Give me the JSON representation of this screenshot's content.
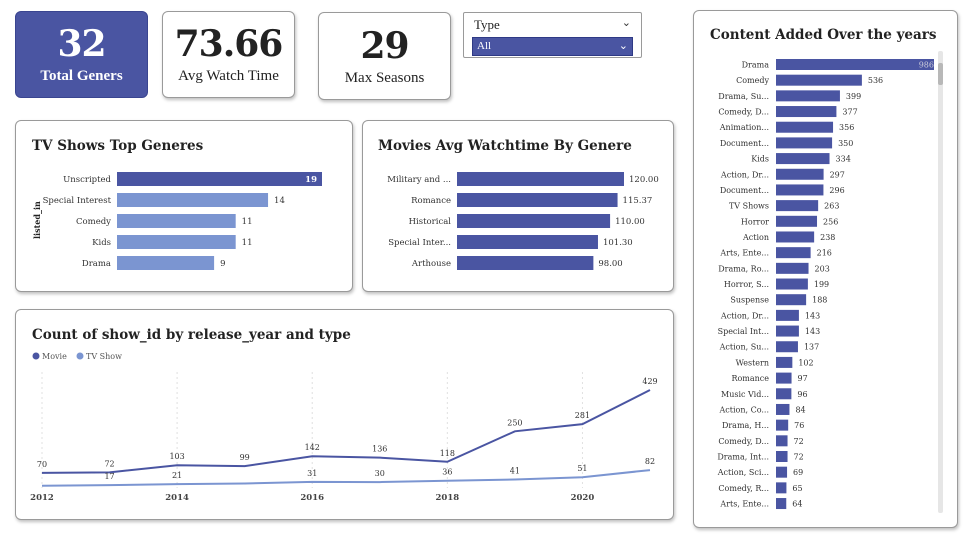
{
  "colors": {
    "primary": "#4a55a2",
    "secondary": "#7b95d1",
    "grid": "#e0e0e0"
  },
  "kpis": [
    {
      "value": "32",
      "label": "Total Geners"
    },
    {
      "value": "73.66",
      "label": "Avg Watch Time"
    },
    {
      "value": "29",
      "label": "Max Seasons"
    }
  ],
  "slicer": {
    "label": "Type",
    "selected": "All",
    "icon": "chevron-down-icon"
  },
  "tv_chart": {
    "title": "TV Shows Top Generes",
    "ylabel": "listed_in",
    "categories": [
      "Unscripted",
      "Special Interest",
      "Comedy",
      "Kids",
      "Drama"
    ],
    "values": [
      19,
      14,
      11,
      11,
      9
    ],
    "labels": [
      "19",
      "14",
      "11",
      "11",
      "9"
    ]
  },
  "movies_chart": {
    "title": "Movies Avg Watchtime By Genere",
    "categories": [
      "Military and ...",
      "Romance",
      "Historical",
      "Special Inter...",
      "Arthouse"
    ],
    "values": [
      120.0,
      115.37,
      110.0,
      101.3,
      98.0
    ],
    "labels": [
      "120.00",
      "115.37",
      "110.00",
      "101.30",
      "98.00"
    ]
  },
  "line_chart": {
    "title": "Count of show_id by release_year and type",
    "x_ticks": [
      "2012",
      "2014",
      "2016",
      "2018",
      "2020"
    ],
    "series": [
      {
        "name": "Movie",
        "x": [
          2012,
          2013,
          2014,
          2015,
          2016,
          2017,
          2018,
          2019,
          2020,
          2021
        ],
        "values": [
          70,
          72,
          103,
          99,
          142,
          136,
          118,
          250,
          281,
          429
        ]
      },
      {
        "name": "TV Show",
        "x": [
          2012,
          2013,
          2014,
          2015,
          2016,
          2017,
          2018,
          2019,
          2020,
          2021
        ],
        "values": [
          14,
          17,
          21,
          24,
          31,
          30,
          36,
          41,
          51,
          82
        ]
      }
    ],
    "point_labels": [
      {
        "x": 2012,
        "y": 70,
        "text": "70"
      },
      {
        "x": 2013,
        "y": 72,
        "text": "72"
      },
      {
        "x": 2013,
        "y": 17,
        "text": "17"
      },
      {
        "x": 2014,
        "y": 103,
        "text": "103"
      },
      {
        "x": 2014,
        "y": 21,
        "text": "21"
      },
      {
        "x": 2015,
        "y": 99,
        "text": "99"
      },
      {
        "x": 2016,
        "y": 142,
        "text": "142"
      },
      {
        "x": 2016,
        "y": 31,
        "text": "31"
      },
      {
        "x": 2017,
        "y": 136,
        "text": "136"
      },
      {
        "x": 2017,
        "y": 30,
        "text": "30"
      },
      {
        "x": 2018,
        "y": 118,
        "text": "118"
      },
      {
        "x": 2018,
        "y": 36,
        "text": "36"
      },
      {
        "x": 2019,
        "y": 250,
        "text": "250"
      },
      {
        "x": 2019,
        "y": 41,
        "text": "41"
      },
      {
        "x": 2020,
        "y": 281,
        "text": "281"
      },
      {
        "x": 2020,
        "y": 51,
        "text": "51"
      },
      {
        "x": 2021,
        "y": 429,
        "text": "429"
      },
      {
        "x": 2021,
        "y": 82,
        "text": "82"
      }
    ]
  },
  "content_chart": {
    "title": "Content Added Over the years",
    "categories": [
      "Drama",
      "Comedy",
      "Drama, Su...",
      "Comedy, D...",
      "Animation...",
      "Document...",
      "Kids",
      "Action, Dr...",
      "Document...",
      "TV Shows",
      "Horror",
      "Action",
      "Arts, Ente...",
      "Drama, Ro...",
      "Horror, S...",
      "Suspense",
      "Action, Dr...",
      "Special Int...",
      "Action, Su...",
      "Western",
      "Romance",
      "Music Vid...",
      "Action, Co...",
      "Drama, H...",
      "Comedy, D...",
      "Drama, Int...",
      "Action, Sci...",
      "Comedy, R...",
      "Arts, Ente..."
    ],
    "values": [
      986,
      536,
      399,
      377,
      356,
      350,
      334,
      297,
      296,
      263,
      256,
      238,
      216,
      203,
      199,
      188,
      143,
      143,
      137,
      102,
      97,
      96,
      84,
      76,
      72,
      72,
      69,
      65,
      64
    ],
    "labels": [
      "986",
      "536",
      "399",
      "377",
      "356",
      "350",
      "334",
      "297",
      "296",
      "263",
      "256",
      "238",
      "216",
      "203",
      "199",
      "188",
      "143",
      "143",
      "137",
      "102",
      "97",
      "96",
      "84",
      "76",
      "72",
      "72",
      "69",
      "65",
      "64"
    ]
  }
}
